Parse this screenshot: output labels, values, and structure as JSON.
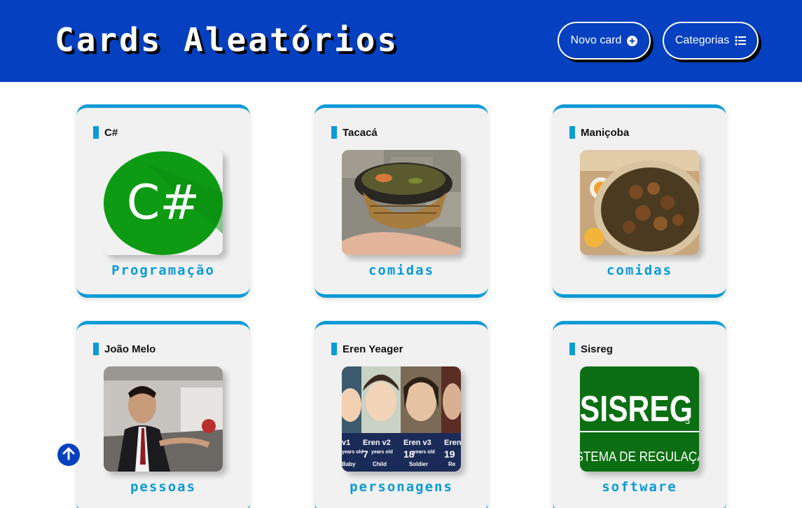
{
  "header": {
    "title": "Cards Aleatórios",
    "new_card_label": "Novo card",
    "categories_label": "Categorias"
  },
  "colors": {
    "header_bg": "#0440bf",
    "accent": "#0a9ad6",
    "card_bg": "#f1f1f1"
  },
  "cards": [
    {
      "title": "C#",
      "category": "Programação",
      "image": "csharp-logo"
    },
    {
      "title": "Tacacá",
      "category": "comidas",
      "image": "tacaca-bowl-photo"
    },
    {
      "title": "Maniçoba",
      "category": "comidas",
      "image": "manicoba-dish-photo"
    },
    {
      "title": "João Melo",
      "category": "pessoas",
      "image": "man-in-car-photo"
    },
    {
      "title": "Eren Yeager",
      "category": "personagens",
      "image": "eren-versions-collage",
      "image_labels": [
        {
          "name": "v1",
          "age": "",
          "stage": "Baby"
        },
        {
          "name": "Eren v2",
          "age": "7",
          "stage": "Child"
        },
        {
          "name": "Eren v3",
          "age": "18",
          "stage": "Soldier"
        },
        {
          "name": "Eren",
          "age": "19",
          "stage": "Re"
        }
      ],
      "years_old": "years old"
    },
    {
      "title": "Sisreg",
      "category": "software",
      "image": "sisreg-logo",
      "image_text": {
        "main": "SISREG",
        "sub": "3",
        "caption": "SISTEMA DE REGULAÇÃO"
      }
    }
  ],
  "csharp_logo_text": "C#",
  "icons": [
    "plus-circle-icon",
    "list-icon",
    "arrow-up-icon"
  ]
}
